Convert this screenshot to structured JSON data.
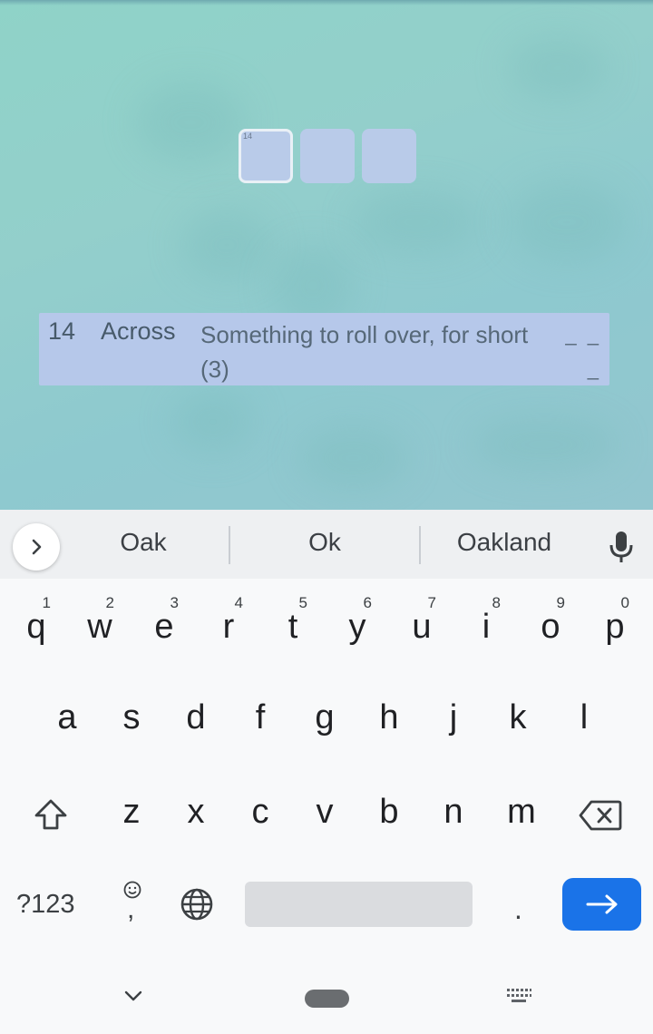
{
  "puzzle": {
    "cells": [
      {
        "number": "14",
        "active": true
      },
      {
        "number": "",
        "active": false
      },
      {
        "number": "",
        "active": false
      }
    ],
    "clue": {
      "number": "14",
      "direction": "Across",
      "text": "Something to roll over, for short (3)",
      "blanks": "_ _ _"
    }
  },
  "suggestions": {
    "expand_icon": "chevron-right-icon",
    "items": [
      "Oak",
      "Ok",
      "Oakland"
    ],
    "mic_icon": "mic-icon"
  },
  "keyboard": {
    "row1": [
      {
        "key": "q",
        "hint": "1"
      },
      {
        "key": "w",
        "hint": "2"
      },
      {
        "key": "e",
        "hint": "3"
      },
      {
        "key": "r",
        "hint": "4"
      },
      {
        "key": "t",
        "hint": "5"
      },
      {
        "key": "y",
        "hint": "6"
      },
      {
        "key": "u",
        "hint": "7"
      },
      {
        "key": "i",
        "hint": "8"
      },
      {
        "key": "o",
        "hint": "9"
      },
      {
        "key": "p",
        "hint": "0"
      }
    ],
    "row2": [
      "a",
      "s",
      "d",
      "f",
      "g",
      "h",
      "j",
      "k",
      "l"
    ],
    "row3": [
      "z",
      "x",
      "c",
      "v",
      "b",
      "n",
      "m"
    ],
    "symbols_label": "?123",
    "comma_label": ",",
    "period_label": ".",
    "shift_icon": "shift-icon",
    "backspace_icon": "backspace-icon",
    "emoji_icon": "emoji-icon",
    "globe_icon": "globe-icon",
    "enter_icon": "arrow-right-icon",
    "accent_color": "#1a73e8"
  },
  "nav": {
    "back_icon": "chevron-down-icon",
    "switch_keyboard_icon": "keyboard-icon"
  }
}
